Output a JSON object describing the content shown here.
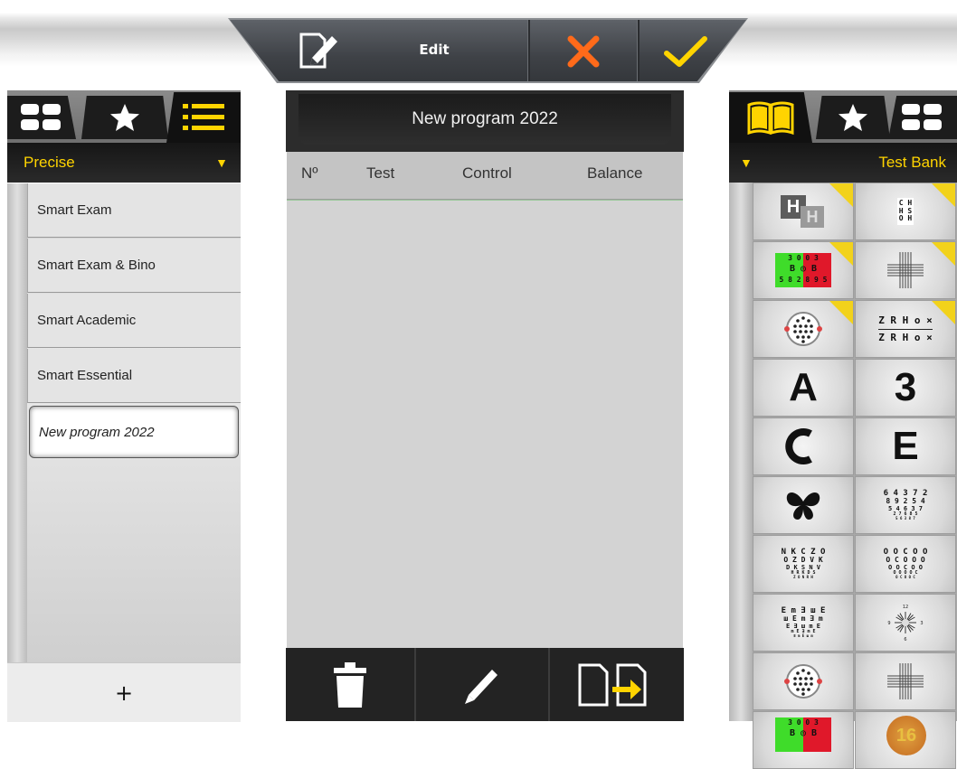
{
  "toolbar": {
    "edit_label": "Edit",
    "icons": [
      "edit-document-icon",
      "cancel-icon",
      "confirm-icon"
    ],
    "colors": {
      "cancel": "#ff6a1a",
      "confirm": "#ffd400"
    }
  },
  "left_panel": {
    "tabs": [
      "grid-icon",
      "star-icon",
      "list-icon"
    ],
    "active_tab": "list-icon",
    "selector_label": "Precise",
    "programs": [
      {
        "label": "Smart Exam"
      },
      {
        "label": "Smart Exam & Bino"
      },
      {
        "label": "Smart Academic"
      },
      {
        "label": "Smart Essential"
      },
      {
        "label": "New program 2022",
        "selected": true
      }
    ],
    "add_label": "+"
  },
  "center_panel": {
    "title": "New program 2022",
    "columns": [
      "Nº",
      "Test",
      "Control",
      "Balance"
    ],
    "actions": [
      "delete-icon",
      "edit-pencil-icon",
      "copy-program-icon"
    ]
  },
  "right_panel": {
    "tabs": [
      "book-icon",
      "star-icon",
      "grid-icon"
    ],
    "active_tab": "book-icon",
    "selector_label": "Test Bank",
    "tiles": [
      {
        "name": "tile-h-fixation",
        "kind": "H",
        "badge": true
      },
      {
        "name": "tile-ch-chart",
        "kind": "CH",
        "badge": true
      },
      {
        "name": "tile-red-green-duochrome",
        "kind": "duochrome",
        "badge": true
      },
      {
        "name": "tile-cross-grid",
        "kind": "cross",
        "badge": true
      },
      {
        "name": "tile-dot-circle",
        "kind": "dots",
        "badge": true
      },
      {
        "name": "tile-zrh-letters",
        "kind": "ZRH",
        "badge": true
      },
      {
        "name": "tile-letter-a",
        "kind": "A",
        "badge": false
      },
      {
        "name": "tile-letter-3",
        "kind": "3",
        "badge": false
      },
      {
        "name": "tile-landolt-c",
        "kind": "C",
        "badge": false
      },
      {
        "name": "tile-tumbling-e",
        "kind": "E",
        "badge": false
      },
      {
        "name": "tile-butterfly",
        "kind": "butterfly",
        "badge": false
      },
      {
        "name": "tile-numbers-chart",
        "kind": "numbers",
        "badge": false
      },
      {
        "name": "tile-nkczo-chart",
        "kind": "nkczo",
        "badge": false
      },
      {
        "name": "tile-landolt-rings-chart",
        "kind": "rings",
        "badge": false
      },
      {
        "name": "tile-e-chart",
        "kind": "echart",
        "badge": false
      },
      {
        "name": "tile-clock-dial",
        "kind": "clock",
        "badge": false
      },
      {
        "name": "tile-dot-circle-2",
        "kind": "dots",
        "badge": false
      },
      {
        "name": "tile-cross-grid-2",
        "kind": "cross",
        "badge": false
      },
      {
        "name": "tile-duochrome-2",
        "kind": "duochrome",
        "badge": false
      },
      {
        "name": "tile-ishihara",
        "kind": "ishihara",
        "badge": false
      }
    ],
    "tile_text": {
      "h": "H",
      "ch_lines": [
        "C H",
        "H S",
        "O H",
        "H",
        "S",
        "O H"
      ],
      "duochrome_top": "3 0  0 3",
      "duochrome_mid": "B ◎ B",
      "duochrome_bot": "5 8 2 8 9 5",
      "zrh_line1": "Z R H o ×",
      "zrh_line2": "Z R H o ×",
      "letter_a": "A",
      "letter_3": "3",
      "letter_c": "C",
      "letter_e": "E",
      "numbers_lines": [
        "6 4 3 7 2",
        "8 9 2 5 4",
        "5 4 6 3 7",
        "2 7 6 8 5",
        "5 6 3 8 7"
      ],
      "nkczo_lines": [
        "N K C Z O",
        "O Z D V K",
        "D K S N V",
        "H R K D S",
        "Z O N R H"
      ],
      "rings_lines": [
        "O O C O O",
        "O C O O O",
        "O O C O O",
        "O O O O C",
        "O C O O C"
      ],
      "echart_lines": [
        "E m ∃ ш E",
        "ш E m ∃ m",
        "E ∃ ш m E",
        "m E ∃ m E",
        "∃ m E ш m"
      ],
      "ishihara": "16"
    }
  }
}
